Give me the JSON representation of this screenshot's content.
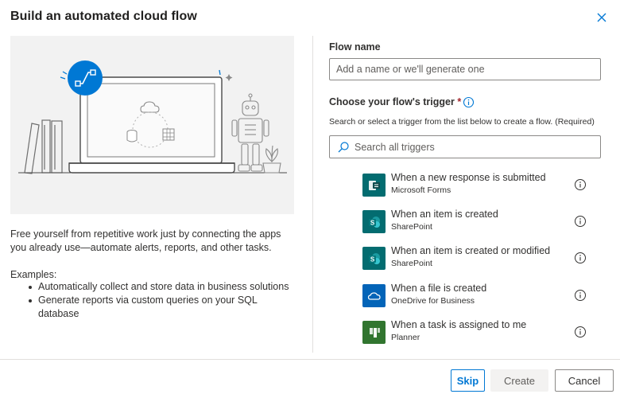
{
  "dialog": {
    "title": "Build an automated cloud flow",
    "close_icon": "close-icon"
  },
  "left": {
    "description": "Free yourself from repetitive work just by connecting the apps you already use—automate alerts, reports, and other tasks.",
    "examples_label": "Examples:",
    "examples": [
      "Automatically collect and store data in business solutions",
      "Generate reports via custom queries on your SQL database"
    ]
  },
  "form": {
    "flow_name_label": "Flow name",
    "flow_name_value": "",
    "flow_name_placeholder": "Add a name or we'll generate one",
    "trigger_label": "Choose your flow's trigger",
    "required_mark": "*",
    "trigger_hint": "Search or select a trigger from the list below to create a flow. (Required)",
    "search_placeholder": "Search all triggers",
    "search_value": ""
  },
  "triggers": [
    {
      "name": "When a new response is submitted",
      "source": "Microsoft Forms",
      "icon": "forms-icon",
      "color": "#036c70"
    },
    {
      "name": "When an item is created",
      "source": "SharePoint",
      "icon": "sharepoint-icon",
      "color": "#036c70"
    },
    {
      "name": "When an item is created or modified",
      "source": "SharePoint",
      "icon": "sharepoint-icon",
      "color": "#036c70"
    },
    {
      "name": "When a file is created",
      "source": "OneDrive for Business",
      "icon": "onedrive-icon",
      "color": "#0364b8"
    },
    {
      "name": "When a task is assigned to me",
      "source": "Planner",
      "icon": "planner-icon",
      "color": "#31752f"
    }
  ],
  "footer": {
    "skip_label": "Skip",
    "create_label": "Create",
    "cancel_label": "Cancel"
  },
  "colors": {
    "accent": "#0078d4",
    "required": "#a4262c",
    "hero_bg": "#f2f2f2"
  }
}
